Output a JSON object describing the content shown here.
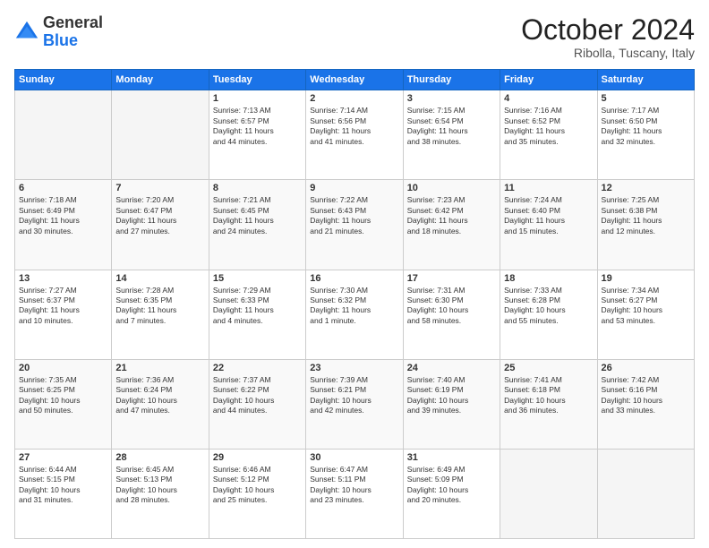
{
  "logo": {
    "general": "General",
    "blue": "Blue"
  },
  "header": {
    "month": "October 2024",
    "location": "Ribolla, Tuscany, Italy"
  },
  "weekdays": [
    "Sunday",
    "Monday",
    "Tuesday",
    "Wednesday",
    "Thursday",
    "Friday",
    "Saturday"
  ],
  "weeks": [
    [
      {
        "day": "",
        "empty": true
      },
      {
        "day": "",
        "empty": true
      },
      {
        "day": "1",
        "line1": "Sunrise: 7:13 AM",
        "line2": "Sunset: 6:57 PM",
        "line3": "Daylight: 11 hours",
        "line4": "and 44 minutes."
      },
      {
        "day": "2",
        "line1": "Sunrise: 7:14 AM",
        "line2": "Sunset: 6:56 PM",
        "line3": "Daylight: 11 hours",
        "line4": "and 41 minutes."
      },
      {
        "day": "3",
        "line1": "Sunrise: 7:15 AM",
        "line2": "Sunset: 6:54 PM",
        "line3": "Daylight: 11 hours",
        "line4": "and 38 minutes."
      },
      {
        "day": "4",
        "line1": "Sunrise: 7:16 AM",
        "line2": "Sunset: 6:52 PM",
        "line3": "Daylight: 11 hours",
        "line4": "and 35 minutes."
      },
      {
        "day": "5",
        "line1": "Sunrise: 7:17 AM",
        "line2": "Sunset: 6:50 PM",
        "line3": "Daylight: 11 hours",
        "line4": "and 32 minutes."
      }
    ],
    [
      {
        "day": "6",
        "line1": "Sunrise: 7:18 AM",
        "line2": "Sunset: 6:49 PM",
        "line3": "Daylight: 11 hours",
        "line4": "and 30 minutes."
      },
      {
        "day": "7",
        "line1": "Sunrise: 7:20 AM",
        "line2": "Sunset: 6:47 PM",
        "line3": "Daylight: 11 hours",
        "line4": "and 27 minutes."
      },
      {
        "day": "8",
        "line1": "Sunrise: 7:21 AM",
        "line2": "Sunset: 6:45 PM",
        "line3": "Daylight: 11 hours",
        "line4": "and 24 minutes."
      },
      {
        "day": "9",
        "line1": "Sunrise: 7:22 AM",
        "line2": "Sunset: 6:43 PM",
        "line3": "Daylight: 11 hours",
        "line4": "and 21 minutes."
      },
      {
        "day": "10",
        "line1": "Sunrise: 7:23 AM",
        "line2": "Sunset: 6:42 PM",
        "line3": "Daylight: 11 hours",
        "line4": "and 18 minutes."
      },
      {
        "day": "11",
        "line1": "Sunrise: 7:24 AM",
        "line2": "Sunset: 6:40 PM",
        "line3": "Daylight: 11 hours",
        "line4": "and 15 minutes."
      },
      {
        "day": "12",
        "line1": "Sunrise: 7:25 AM",
        "line2": "Sunset: 6:38 PM",
        "line3": "Daylight: 11 hours",
        "line4": "and 12 minutes."
      }
    ],
    [
      {
        "day": "13",
        "line1": "Sunrise: 7:27 AM",
        "line2": "Sunset: 6:37 PM",
        "line3": "Daylight: 11 hours",
        "line4": "and 10 minutes."
      },
      {
        "day": "14",
        "line1": "Sunrise: 7:28 AM",
        "line2": "Sunset: 6:35 PM",
        "line3": "Daylight: 11 hours",
        "line4": "and 7 minutes."
      },
      {
        "day": "15",
        "line1": "Sunrise: 7:29 AM",
        "line2": "Sunset: 6:33 PM",
        "line3": "Daylight: 11 hours",
        "line4": "and 4 minutes."
      },
      {
        "day": "16",
        "line1": "Sunrise: 7:30 AM",
        "line2": "Sunset: 6:32 PM",
        "line3": "Daylight: 11 hours",
        "line4": "and 1 minute."
      },
      {
        "day": "17",
        "line1": "Sunrise: 7:31 AM",
        "line2": "Sunset: 6:30 PM",
        "line3": "Daylight: 10 hours",
        "line4": "and 58 minutes."
      },
      {
        "day": "18",
        "line1": "Sunrise: 7:33 AM",
        "line2": "Sunset: 6:28 PM",
        "line3": "Daylight: 10 hours",
        "line4": "and 55 minutes."
      },
      {
        "day": "19",
        "line1": "Sunrise: 7:34 AM",
        "line2": "Sunset: 6:27 PM",
        "line3": "Daylight: 10 hours",
        "line4": "and 53 minutes."
      }
    ],
    [
      {
        "day": "20",
        "line1": "Sunrise: 7:35 AM",
        "line2": "Sunset: 6:25 PM",
        "line3": "Daylight: 10 hours",
        "line4": "and 50 minutes."
      },
      {
        "day": "21",
        "line1": "Sunrise: 7:36 AM",
        "line2": "Sunset: 6:24 PM",
        "line3": "Daylight: 10 hours",
        "line4": "and 47 minutes."
      },
      {
        "day": "22",
        "line1": "Sunrise: 7:37 AM",
        "line2": "Sunset: 6:22 PM",
        "line3": "Daylight: 10 hours",
        "line4": "and 44 minutes."
      },
      {
        "day": "23",
        "line1": "Sunrise: 7:39 AM",
        "line2": "Sunset: 6:21 PM",
        "line3": "Daylight: 10 hours",
        "line4": "and 42 minutes."
      },
      {
        "day": "24",
        "line1": "Sunrise: 7:40 AM",
        "line2": "Sunset: 6:19 PM",
        "line3": "Daylight: 10 hours",
        "line4": "and 39 minutes."
      },
      {
        "day": "25",
        "line1": "Sunrise: 7:41 AM",
        "line2": "Sunset: 6:18 PM",
        "line3": "Daylight: 10 hours",
        "line4": "and 36 minutes."
      },
      {
        "day": "26",
        "line1": "Sunrise: 7:42 AM",
        "line2": "Sunset: 6:16 PM",
        "line3": "Daylight: 10 hours",
        "line4": "and 33 minutes."
      }
    ],
    [
      {
        "day": "27",
        "line1": "Sunrise: 6:44 AM",
        "line2": "Sunset: 5:15 PM",
        "line3": "Daylight: 10 hours",
        "line4": "and 31 minutes."
      },
      {
        "day": "28",
        "line1": "Sunrise: 6:45 AM",
        "line2": "Sunset: 5:13 PM",
        "line3": "Daylight: 10 hours",
        "line4": "and 28 minutes."
      },
      {
        "day": "29",
        "line1": "Sunrise: 6:46 AM",
        "line2": "Sunset: 5:12 PM",
        "line3": "Daylight: 10 hours",
        "line4": "and 25 minutes."
      },
      {
        "day": "30",
        "line1": "Sunrise: 6:47 AM",
        "line2": "Sunset: 5:11 PM",
        "line3": "Daylight: 10 hours",
        "line4": "and 23 minutes."
      },
      {
        "day": "31",
        "line1": "Sunrise: 6:49 AM",
        "line2": "Sunset: 5:09 PM",
        "line3": "Daylight: 10 hours",
        "line4": "and 20 minutes."
      },
      {
        "day": "",
        "empty": true
      },
      {
        "day": "",
        "empty": true
      }
    ]
  ]
}
